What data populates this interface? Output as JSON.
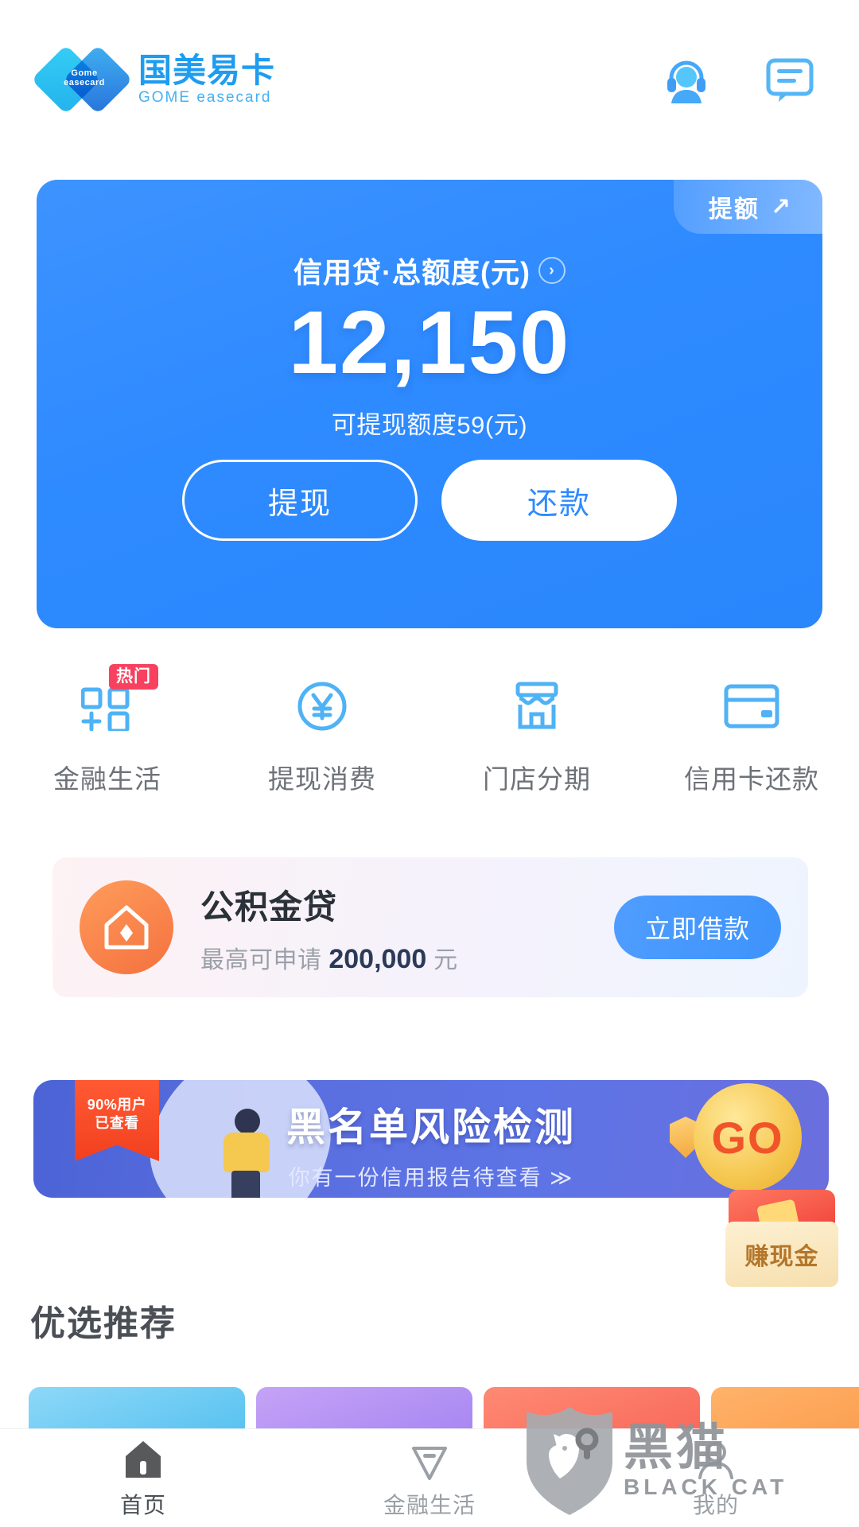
{
  "header": {
    "brand_cn": "国美易卡",
    "brand_en": "GOME easecard",
    "mark_text": "Gome easecard",
    "service_icon": "headset-customer-service-icon",
    "message_icon": "message-bubble-icon"
  },
  "credit_card": {
    "badge_label": "提额",
    "badge_arrow": "↗",
    "title": "信用贷·总额度(元)",
    "chevron": "›",
    "amount": "12,150",
    "subtitle": "可提现额度59(元)",
    "withdraw_button": "提现",
    "repay_button": "还款",
    "bg_color": "#2E8AFF"
  },
  "quick_actions": [
    {
      "label": "金融生活",
      "icon": "grid-plus-icon",
      "badge": "热门",
      "badge_color": "#F8415F"
    },
    {
      "label": "提现消费",
      "icon": "yen-circle-icon",
      "badge": ""
    },
    {
      "label": "门店分期",
      "icon": "storefront-icon",
      "badge": ""
    },
    {
      "label": "信用卡还款",
      "icon": "credit-card-icon",
      "badge": ""
    }
  ],
  "fund_loan": {
    "icon": "house-icon",
    "title": "公积金贷",
    "desc_prefix": "最高可申请",
    "amount": "200,000",
    "desc_suffix": "元",
    "button": "立即借款",
    "accent_color": "#3D93FB"
  },
  "promo": {
    "ribbon_line1": "90%用户",
    "ribbon_line2": "已查看",
    "headline": "黑名单风险检测",
    "subline": "你有一份信用报告待查看 ≫",
    "go_label": "GO",
    "shield_icon": "shield-icon",
    "redpack_label": "赚现金"
  },
  "section": {
    "title": "优选推荐",
    "cards": [
      {
        "color": "#6FCBF2"
      },
      {
        "color": "#AE8CF3"
      },
      {
        "color": "#FA7363"
      },
      {
        "color": "#FCA452"
      }
    ]
  },
  "tabbar": [
    {
      "label": "首页",
      "icon": "home-icon",
      "active": true
    },
    {
      "label": "金融生活",
      "icon": "diamond-tag-icon",
      "active": false
    },
    {
      "label": "我的",
      "icon": "person-icon",
      "active": false
    }
  ],
  "watermark": {
    "cn": "黑猫",
    "en": "BLACK CAT",
    "icon": "black-cat-shield-icon"
  }
}
